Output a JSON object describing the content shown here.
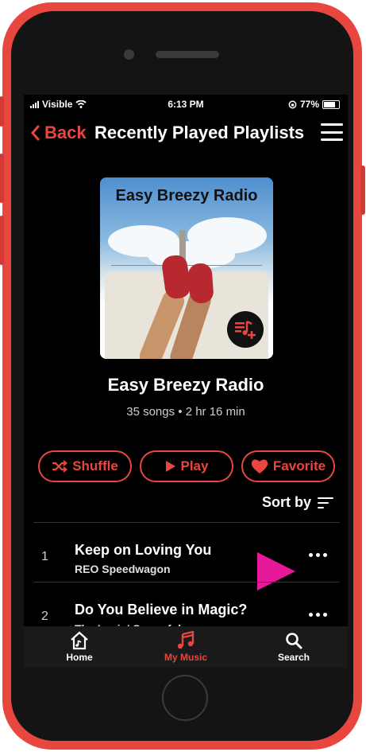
{
  "status_bar": {
    "carrier": "Visible",
    "time": "6:13 PM",
    "battery": "77%"
  },
  "nav": {
    "back_label": "Back",
    "title": "Recently Played Playlists"
  },
  "cover": {
    "title": "Easy Breezy Radio"
  },
  "playlist": {
    "title": "Easy Breezy Radio",
    "meta": "35 songs • 2 hr 16 min"
  },
  "actions": {
    "shuffle": "Shuffle",
    "play": "Play",
    "favorite": "Favorite"
  },
  "sort": {
    "label": "Sort by"
  },
  "tracks": [
    {
      "number": "1",
      "title": "Keep on Loving You",
      "artist": "REO Speedwagon"
    },
    {
      "number": "2",
      "title": "Do You Believe in Magic?",
      "artist": "The Lovin' Spoonful"
    }
  ],
  "tabs": [
    {
      "label": "Home",
      "icon": "home-icon"
    },
    {
      "label": "My Music",
      "icon": "music-note-icon",
      "active": true
    },
    {
      "label": "Search",
      "icon": "search-icon"
    }
  ],
  "colors": {
    "accent": "#e8473f",
    "highlight": "#e5199a",
    "background": "#000000",
    "phone_frame": "#e8473f"
  }
}
